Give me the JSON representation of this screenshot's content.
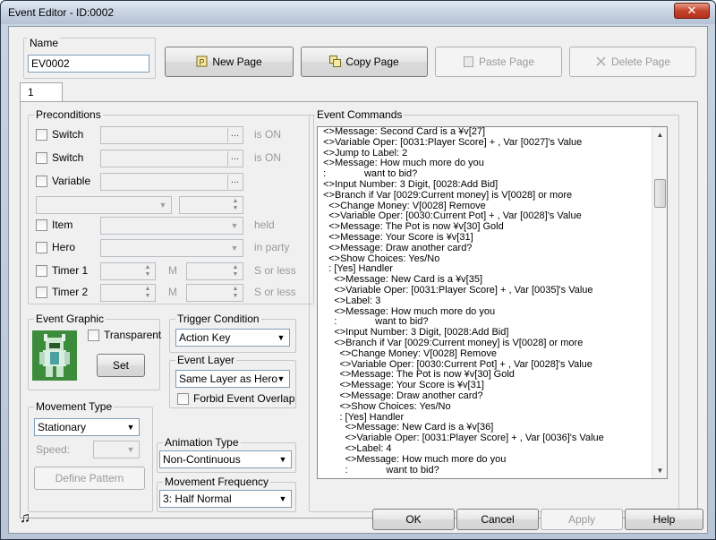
{
  "window": {
    "title": "Event Editor - ID:0002",
    "close_glyph": "✕"
  },
  "name_section": {
    "legend": "Name",
    "value": "EV0002"
  },
  "toolbar": {
    "new_page": "New Page",
    "copy_page": "Copy Page",
    "paste_page": "Paste Page",
    "delete_page": "Delete Page"
  },
  "tabs": [
    {
      "label": "1"
    }
  ],
  "preconditions": {
    "legend": "Preconditions",
    "switch1_label": "Switch",
    "switch1_suffix": "is ON",
    "switch2_label": "Switch",
    "switch2_suffix": "is ON",
    "variable_label": "Variable",
    "item_label": "Item",
    "item_suffix": "held",
    "hero_label": "Hero",
    "hero_suffix": "in party",
    "timer1_label": "Timer 1",
    "timer1_unit": "M",
    "timer1_suffix": "S or less",
    "timer2_label": "Timer 2",
    "timer2_unit": "M",
    "timer2_suffix": "S or less",
    "dots": "..."
  },
  "event_graphic": {
    "legend": "Event Graphic",
    "transparent_label": "Transparent",
    "set_button": "Set"
  },
  "trigger_condition": {
    "legend": "Trigger Condition",
    "selected": "Action Key"
  },
  "event_layer": {
    "legend": "Event Layer",
    "selected": "Same Layer as Hero",
    "forbid_overlap_label": "Forbid Event Overlap"
  },
  "movement_type": {
    "legend": "Movement Type",
    "selected": "Stationary",
    "speed_label": "Speed:",
    "define_pattern": "Define Pattern"
  },
  "animation_type": {
    "legend": "Animation Type",
    "selected": "Non-Continuous"
  },
  "movement_frequency": {
    "legend": "Movement Frequency",
    "selected": "3: Half Normal"
  },
  "event_commands": {
    "legend": "Event Commands",
    "lines": [
      "  <>Message: Second Card is a ¥v[27]",
      "  <>Variable Oper: [0031:Player Score] + , Var [0027]'s Value",
      "  <>Jump to Label: 2",
      "  <>Message: How much more do you",
      "  :              want to bid?",
      "  <>Input Number: 3 Digit, [0028:Add Bid]",
      "  <>Branch if Var [0029:Current money] is V[0028] or more",
      "    <>Change Money: V[0028] Remove",
      "    <>Variable Oper: [0030:Current Pot] + , Var [0028]'s Value",
      "    <>Message: The Pot is now ¥v[30] Gold",
      "    <>Message: Your Score is ¥v[31]",
      "    <>Message: Draw another card?",
      "    <>Show Choices: Yes/No",
      "    : [Yes] Handler",
      "      <>Message: New Card is a ¥v[35]",
      "      <>Variable Oper: [0031:Player Score] + , Var [0035]'s Value",
      "      <>Label: 3",
      "      <>Message: How much more do you",
      "      :              want to bid?",
      "      <>Input Number: 3 Digit, [0028:Add Bid]",
      "      <>Branch if Var [0029:Current money] is V[0028] or more",
      "        <>Change Money: V[0028] Remove",
      "        <>Variable Oper: [0030:Current Pot] + , Var [0028]'s Value",
      "        <>Message: The Pot is now ¥v[30] Gold",
      "        <>Message: Your Score is ¥v[31]",
      "        <>Message: Draw another card?",
      "        <>Show Choices: Yes/No",
      "        : [Yes] Handler",
      "          <>Message: New Card is a ¥v[36]",
      "          <>Variable Oper: [0031:Player Score] + , Var [0036]'s Value",
      "          <>Label: 4",
      "          <>Message: How much more do you",
      "          :              want to bid?"
    ]
  },
  "footer": {
    "ok": "OK",
    "cancel": "Cancel",
    "apply": "Apply",
    "help": "Help",
    "music_glyph": "♫"
  }
}
